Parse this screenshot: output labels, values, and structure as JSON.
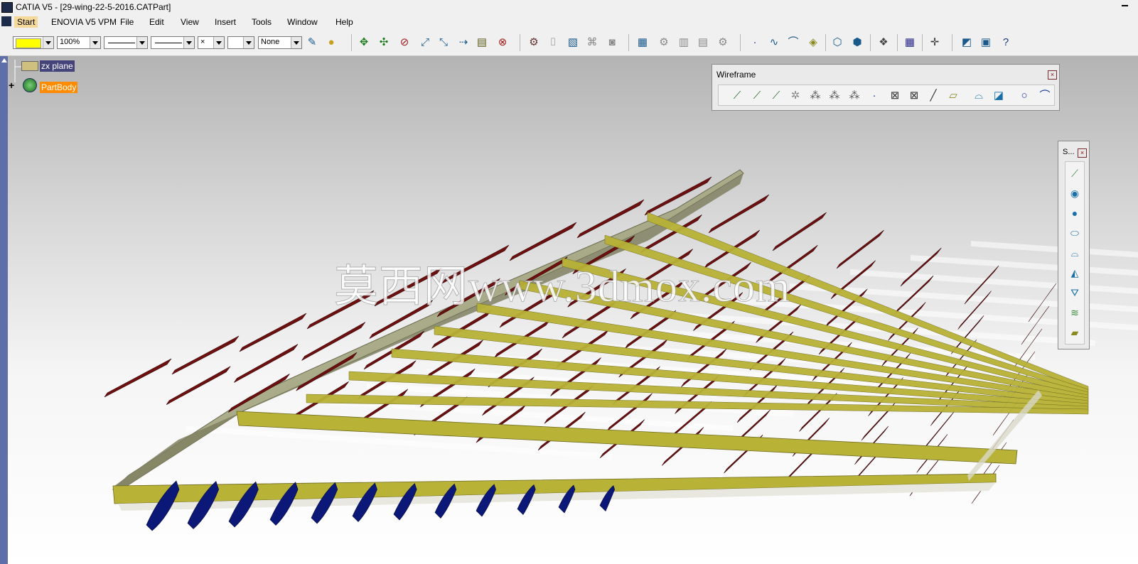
{
  "window": {
    "title": "CATIA V5 - [29-wing-22-5-2016.CATPart]"
  },
  "menubar": {
    "items": [
      "Start",
      "ENOVIA V5 VPM",
      "File",
      "Edit",
      "View",
      "Insert",
      "Tools",
      "Window",
      "Help"
    ],
    "active": "Start"
  },
  "toolbar": {
    "color_value": "",
    "color_swatch": "#ffff00",
    "transparency_value": "100%",
    "linetype_value": "",
    "thickness_value": "",
    "point_symbol_value": "×",
    "layer_value": "None",
    "icons": [
      "painter-icon",
      "apply-material-icon",
      "pan-icon",
      "rotate-icon",
      "fly-icon",
      "zoom-in-icon",
      "zoom-out-icon",
      "normal-view-icon",
      "hide-show-icon",
      "swap-visible-icon",
      "snap-icon",
      "measure-icon",
      "measure-item-icon",
      "measure-inertia-icon",
      "analysis-icon",
      "knowledge-icon",
      "formula-icon",
      "law-icon",
      "design-table-icon",
      "part-design-icon",
      "sketch-icon",
      "point-icon",
      "spline-icon",
      "surface-icon",
      "extract-icon",
      "join-icon",
      "healing-icon",
      "apply-icon",
      "grid-icon",
      "compass-icon",
      "catalog-icon",
      "tree-icon",
      "whats-this-icon"
    ]
  },
  "tree": {
    "nodes": [
      {
        "label": "zx plane",
        "icon": "plane-icon"
      },
      {
        "label": "PartBody",
        "icon": "part-body-icon"
      }
    ]
  },
  "wireframe_toolbar": {
    "title": "Wireframe",
    "icons": [
      "point-icon",
      "points-and-planes-icon",
      "extremum-icon",
      "polar-extremum-icon",
      "grid-pattern-icon",
      "grid-pattern-2-icon",
      "grid-pattern-3-icon",
      "dot-icon",
      "projection-icon",
      "intersection-icon",
      "line-icon",
      "plane-icon",
      "offset-icon",
      "boundary-icon",
      "circle-icon",
      "corner-icon"
    ]
  },
  "surfaces_toolbar": {
    "title": "S...",
    "icons": [
      "extrude-icon",
      "revolve-icon",
      "sphere-icon",
      "cylinder-icon",
      "offset-surface-icon",
      "sweep-icon",
      "fill-icon",
      "multi-section-icon",
      "blend-icon"
    ]
  },
  "watermark": "莫西网www.3dmox.com",
  "colors": {
    "skin": "#8a8c6a",
    "spar": "#b8b236",
    "rib": "#6e0f10",
    "rib_lower": "#0c1878",
    "tree_selected": "#44447a",
    "tree_partbody": "#ff8c00"
  }
}
